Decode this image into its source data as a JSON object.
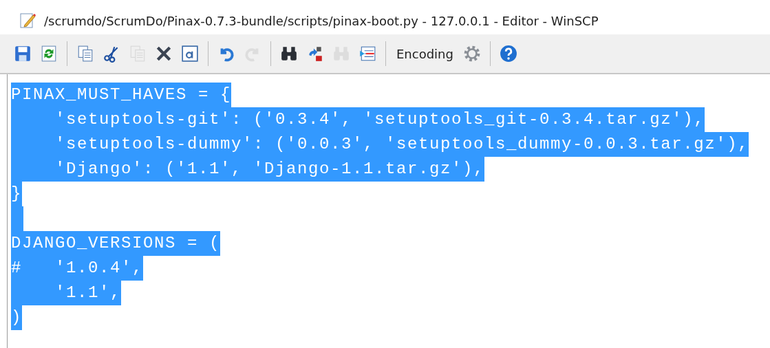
{
  "window": {
    "title": "/scrumdo/ScrumDo/Pinax-0.7.3-bundle/scripts/pinax-boot.py - 127.0.0.1 - Editor - WinSCP"
  },
  "toolbar": [
    {
      "kind": "save",
      "disabled": false
    },
    {
      "kind": "reload",
      "disabled": false
    },
    {
      "kind": "separator"
    },
    {
      "kind": "copy",
      "disabled": false
    },
    {
      "kind": "cut",
      "disabled": false
    },
    {
      "kind": "paste",
      "disabled": true
    },
    {
      "kind": "delete",
      "disabled": false
    },
    {
      "kind": "select-all",
      "disabled": false
    },
    {
      "kind": "separator"
    },
    {
      "kind": "undo",
      "disabled": false
    },
    {
      "kind": "redo",
      "disabled": true
    },
    {
      "kind": "separator"
    },
    {
      "kind": "find",
      "disabled": false
    },
    {
      "kind": "replace",
      "disabled": false
    },
    {
      "kind": "find-next",
      "disabled": true
    },
    {
      "kind": "goto-line",
      "disabled": false
    },
    {
      "kind": "separator"
    },
    {
      "kind": "text",
      "label": "Encoding",
      "disabled": false
    },
    {
      "kind": "settings",
      "disabled": false
    },
    {
      "kind": "separator"
    },
    {
      "kind": "help",
      "disabled": false
    }
  ],
  "editor": {
    "lines": [
      {
        "text": "PINAX_MUST_HAVES = {",
        "selected": true
      },
      {
        "text": "    'setuptools-git': ('0.3.4', 'setuptools_git-0.3.4.tar.gz'),",
        "selected": true
      },
      {
        "text": "    'setuptools-dummy': ('0.0.3', 'setuptools_dummy-0.0.3.tar.gz'),",
        "selected": true
      },
      {
        "text": "    'Django': ('1.1', 'Django-1.1.tar.gz'),",
        "selected": true
      },
      {
        "text": "}",
        "selected": true
      },
      {
        "selected": true
      },
      {
        "text": "DJANGO_VERSIONS = (",
        "selected": true
      },
      {
        "text": "#   '1.0.4',",
        "selected": true
      },
      {
        "text": "    '1.1',",
        "selected": true
      },
      {
        "text": ")",
        "selected": true
      }
    ]
  }
}
